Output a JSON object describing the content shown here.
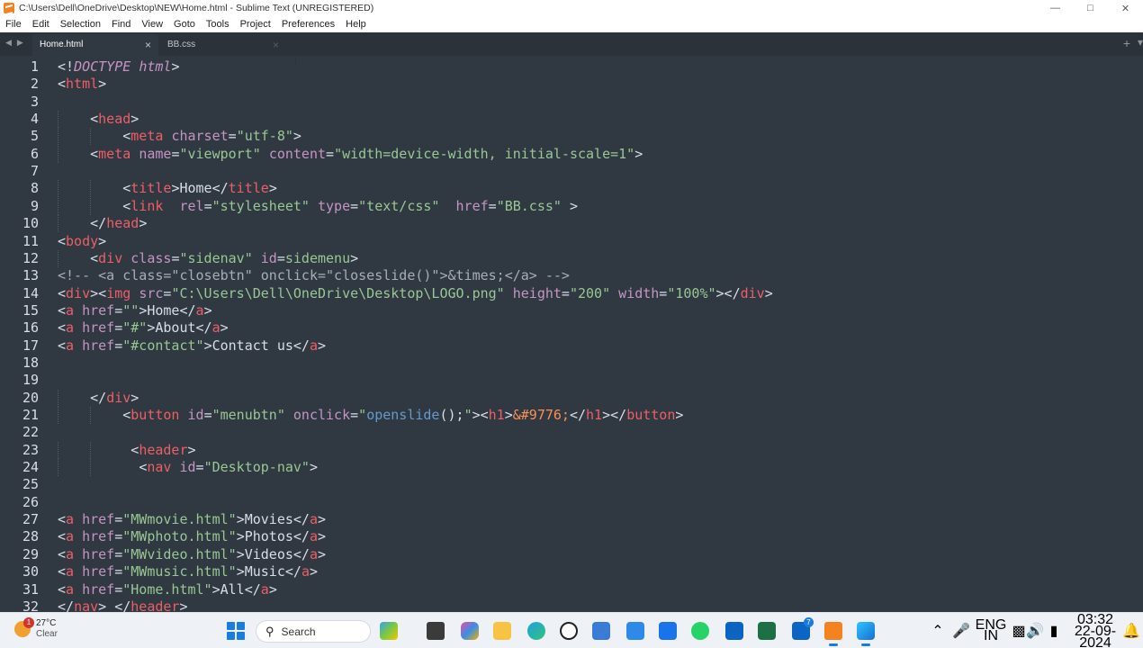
{
  "window": {
    "title": "C:\\Users\\Dell\\OneDrive\\Desktop\\NEW\\Home.html - Sublime Text (UNREGISTERED)"
  },
  "menu": [
    "File",
    "Edit",
    "Selection",
    "Find",
    "View",
    "Goto",
    "Tools",
    "Project",
    "Preferences",
    "Help"
  ],
  "tabs": [
    {
      "label": "Home.html",
      "active": true
    },
    {
      "label": "BB.css",
      "active": false
    }
  ],
  "editor": {
    "line_numbers": [
      "1",
      "2",
      "3",
      "4",
      "5",
      "6",
      "7",
      "8",
      "9",
      "10",
      "11",
      "12",
      "13",
      "14",
      "15",
      "16",
      "17",
      "18",
      "19",
      "20",
      "21",
      "22",
      "23",
      "24",
      "25",
      "26",
      "27",
      "28",
      "29",
      "30",
      "31",
      "32"
    ],
    "lines": [
      "<!DOCTYPE html>",
      "<html>",
      "",
      "    <head>",
      "        <meta charset=\"utf-8\">",
      "    <meta name=\"viewport\" content=\"width=device-width, initial-scale=1\">",
      "",
      "        <title>Home</title>",
      "        <link  rel=\"stylesheet\" type=\"text/css\"  href=\"BB.css\" >",
      "    </head>",
      "<body>",
      "    <div class=\"sidenav\" id=sidemenu>",
      "<!-- <a class=\"closebtn\" onclick=\"closeslide()\">&times;</a> -->",
      "<div><img src=\"C:\\Users\\Dell\\OneDrive\\Desktop\\LOGO.png\" height=\"200\" width=\"100%\"></div>",
      "<a href=\"\">Home</a>",
      "<a href=\"#\">About</a>",
      "<a href=\"#contact\">Contact us</a>",
      "",
      "",
      "    </div>",
      "        <button id=\"menubtn\" onclick=\"openslide();\"><h1>&#9776;</h1></button>",
      "",
      "         <header>",
      "          <nav id=\"Desktop-nav\">",
      "",
      "",
      "<a href=\"MWmovie.html\">Movies</a>",
      "<a href=\"MWphoto.html\">Photos</a>",
      "<a href=\"MWvideo.html\">Videos</a>",
      "<a href=\"MWmusic.html\">Music</a>",
      "<a href=\"Home.html\">All</a>",
      "</nav> </header>"
    ]
  },
  "taskbar": {
    "weather": {
      "temp": "27°C",
      "condition": "Clear",
      "badge": "1"
    },
    "search_label": "Search",
    "apps": [
      "edge-copilot-icon",
      "file-explorer-icon",
      "copilot-icon",
      "folder-icon",
      "edge-icon",
      "dell-icon",
      "store-icon",
      "notepad-icon",
      "mail-icon",
      "whatsapp-icon",
      "outlook-icon",
      "excel-icon",
      "linkedin-icon",
      "sublime-icon",
      "snipping-tool-icon"
    ],
    "linkedin_badge": "7",
    "language": {
      "line1": "ENG",
      "line2": "IN"
    },
    "clock": {
      "time": "03:32",
      "date": "22-09-2024"
    }
  },
  "colors": {
    "editor_bg": "#303841",
    "tag": "#ec5f67",
    "attr": "#c594c5",
    "string": "#99c794",
    "text": "#d8dee9"
  }
}
